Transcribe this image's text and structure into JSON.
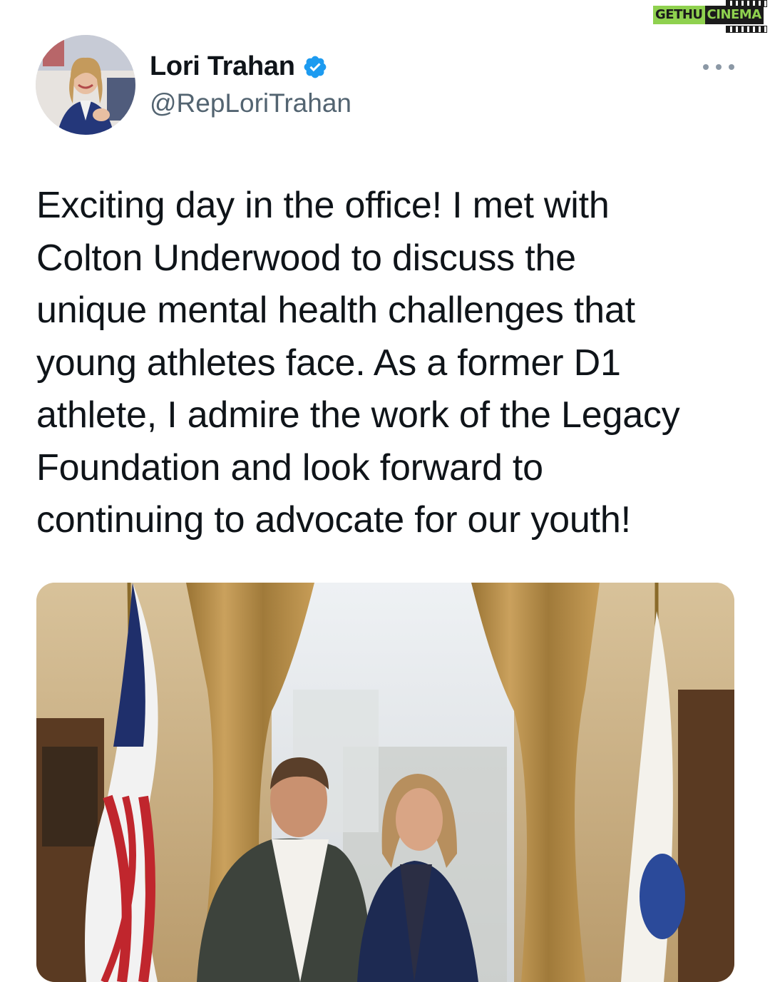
{
  "watermark": {
    "part1": "GETHU",
    "part2": "CINEMA"
  },
  "tweet": {
    "author": {
      "display_name": "Lori Trahan",
      "handle": "@RepLoriTrahan",
      "verified": true,
      "avatar_icon": "profile-photo"
    },
    "more_icon": "more-options-icon",
    "text": "Exciting day in the office! I met with\nColton Underwood to discuss the\nunique mental health challenges that\nyoung athletes face. As a former D1\nathlete, I admire the work of the Legacy\nFoundation and look forward to\ncontinuing to advocate for our youth!",
    "media": {
      "type": "photo"
    }
  },
  "colors": {
    "text_primary": "#0f1419",
    "text_secondary": "#536471",
    "verified_blue": "#1d9bf0",
    "watermark_green": "#8fd14f"
  }
}
